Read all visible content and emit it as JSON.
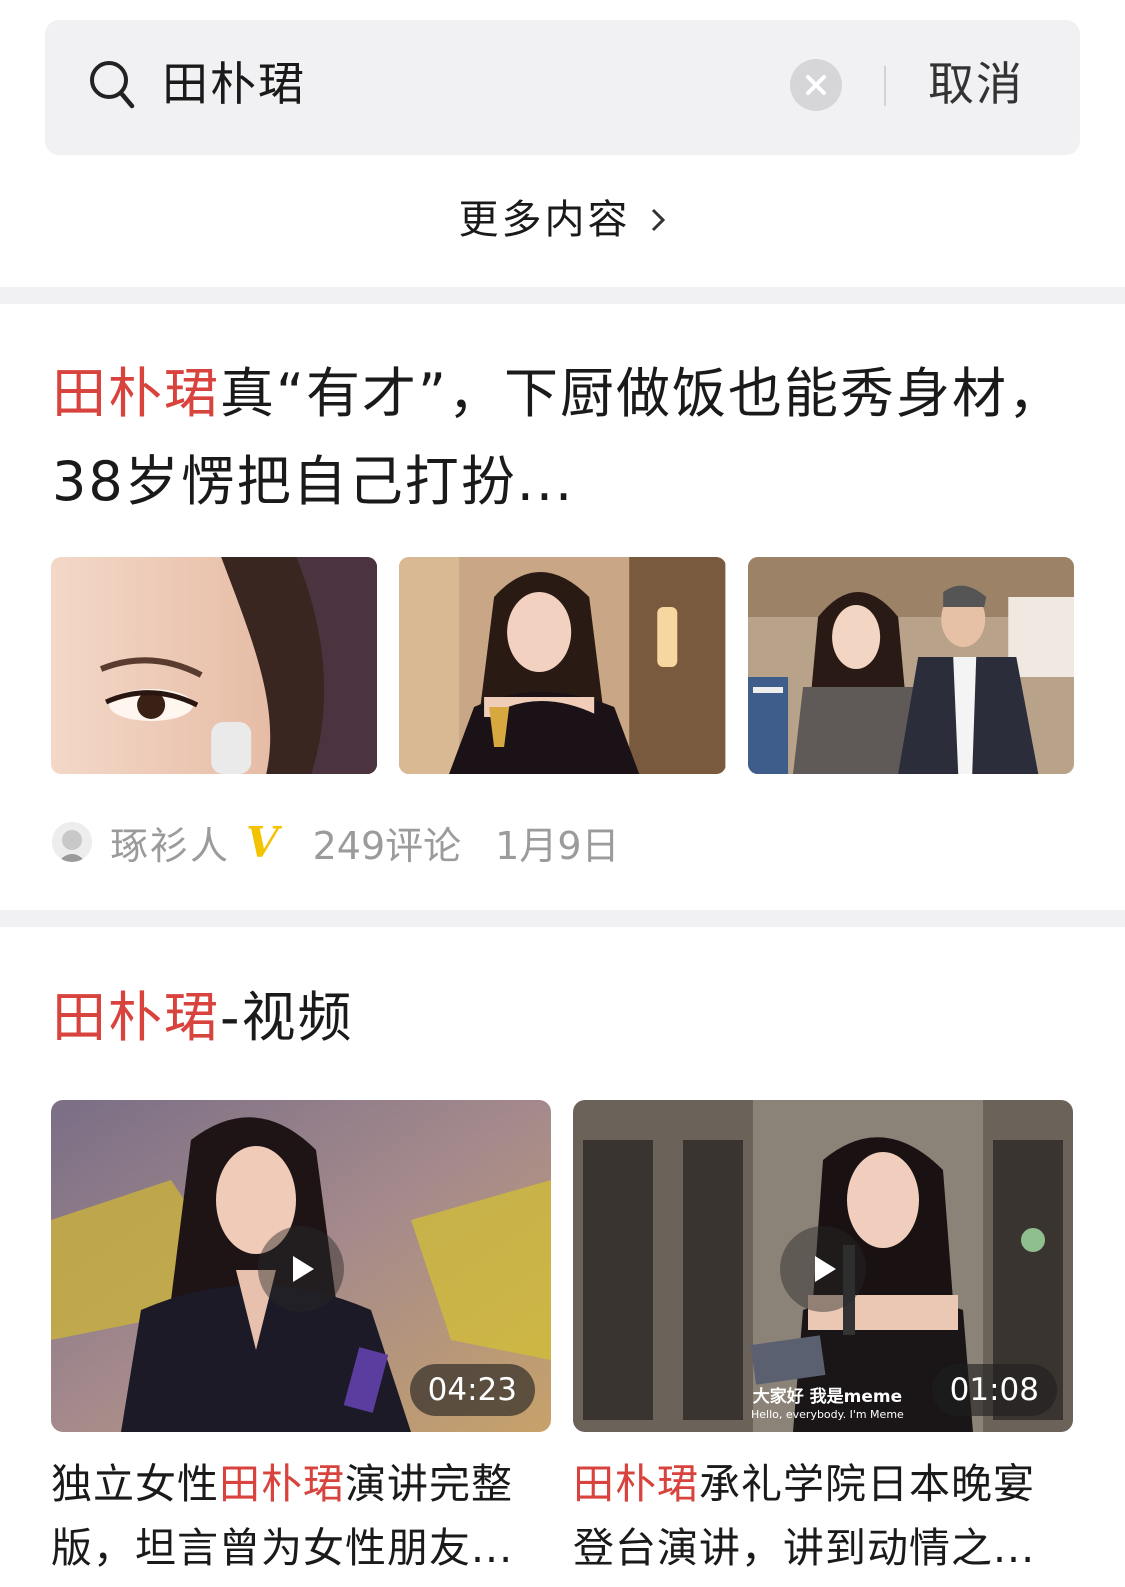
{
  "search": {
    "query": "田朴珺",
    "cancel_label": "取消"
  },
  "more_content": {
    "label": "更多内容"
  },
  "article": {
    "title_highlight": "田朴珺",
    "title_rest": "真“有才”，下厨做饭也能秀身材，38岁愣把自己打扮...",
    "author": "琢衫人",
    "verified_badge": "V",
    "comments": "249评论",
    "date": "1月9日"
  },
  "videos": {
    "heading_highlight": "田朴珺",
    "heading_rest": "-视频",
    "items": [
      {
        "duration": "04:23",
        "title_before": "独立女性",
        "title_highlight": "田朴珺",
        "title_after": "演讲完整版，坦言曾为女性朋友..."
      },
      {
        "duration": "01:08",
        "title_before": "",
        "title_highlight": "田朴珺",
        "title_after": "承礼学院日本晚宴登台演讲，讲到动情之...",
        "caption_main": "大家好 我是meme",
        "caption_sub": "Hello, everybody. I'm Meme"
      }
    ]
  },
  "colors": {
    "highlight": "#d9433d",
    "badge": "#f3c300",
    "separator": "#f1f1f3"
  }
}
